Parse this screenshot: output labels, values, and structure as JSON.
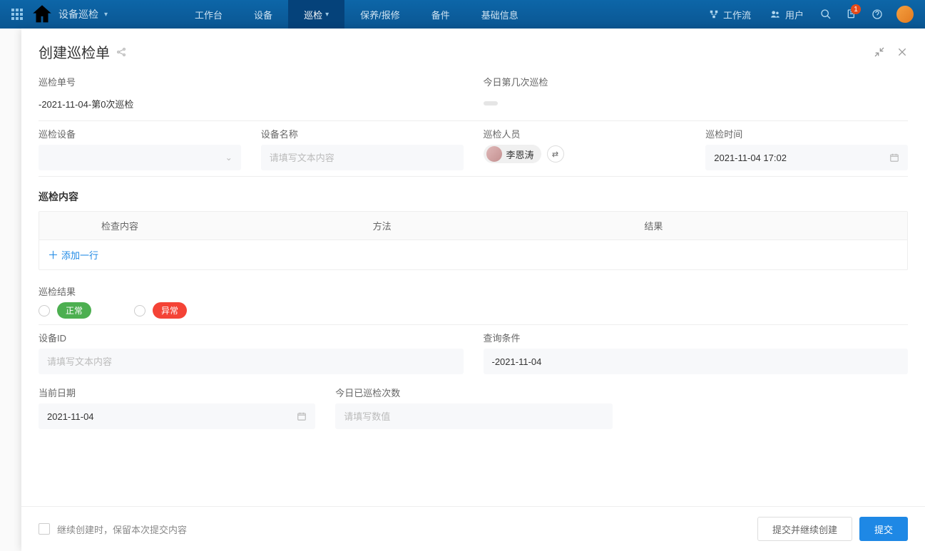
{
  "nav": {
    "app_title": "设备巡检",
    "tabs": [
      "工作台",
      "设备",
      "巡检",
      "保养/报修",
      "备件",
      "基础信息"
    ],
    "active_tab_index": 2,
    "right": {
      "workflow": "工作流",
      "users": "用户",
      "notif_count": "1"
    }
  },
  "modal": {
    "title": "创建巡检单",
    "labels": {
      "order_no": "巡检单号",
      "today_count": "今日第几次巡检",
      "equipment": "巡检设备",
      "equipment_name": "设备名称",
      "inspector": "巡检人员",
      "inspect_time": "巡检时间",
      "content_section": "巡检内容",
      "result_section": "巡检结果",
      "equipment_id": "设备ID",
      "query_cond": "查询条件",
      "current_date": "当前日期",
      "today_done_count": "今日已巡检次数"
    },
    "values": {
      "order_no": "-2021-11-04-第0次巡检",
      "inspector_name": "李恩涛",
      "inspect_time": "2021-11-04 17:02",
      "query_cond": "-2021-11-04",
      "current_date": "2021-11-04"
    },
    "placeholders": {
      "text": "请填写文本内容",
      "number": "请填写数值"
    },
    "table": {
      "headers": [
        "检查内容",
        "方法",
        "结果"
      ],
      "add_row": "添加一行"
    },
    "result_options": {
      "normal": "正常",
      "abnormal": "异常"
    },
    "footer": {
      "keep_content": "继续创建时，保留本次提交内容",
      "submit_continue": "提交并继续创建",
      "submit": "提交"
    }
  },
  "rail_colors": [
    "#f5c26b",
    "#5aa9e6",
    "#9aa0a6",
    "#f5a23c",
    "#f0c419",
    "#b3b3b3",
    "#5aa9e6",
    "#8e8e93",
    "#e53935",
    "#ff8a4c"
  ]
}
